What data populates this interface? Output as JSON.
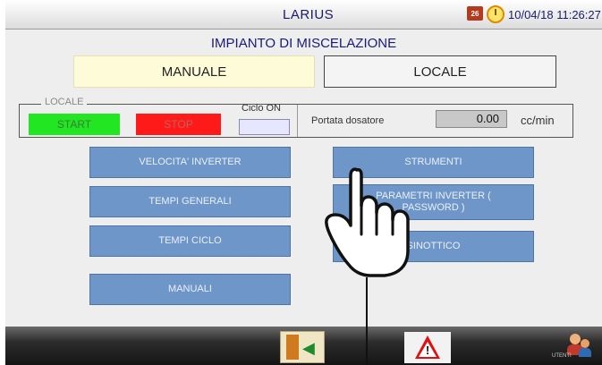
{
  "header": {
    "title": "LARIUS",
    "calendar_icon": "calendar-icon",
    "calendar_day": "26",
    "clock_icon": "clock-icon",
    "datetime": "10/04/18 11:26:27"
  },
  "page_title": "IMPIANTO DI MISCELAZIONE",
  "modes": {
    "manual_label": "MANUALE",
    "local_label": "LOCALE"
  },
  "control": {
    "group_label": "LOCALE",
    "start_label": "START",
    "stop_label": "STOP",
    "ciclo_label": "Ciclo ON",
    "portata_label": "Portata dosatore",
    "portata_value": "0.00",
    "portata_unit": "cc/min"
  },
  "menu": {
    "velocita_inverter": "VELOCITA' INVERTER",
    "tempi_generali": "TEMPI GENERALI",
    "tempi_ciclo": "TEMPI CICLO",
    "manuali": "MANUALI",
    "strumenti": "STRUMENTI",
    "parametri_inverter": "PARAMETRI INVERTER ( PASSWORD )",
    "sinottico": "SINOTTICO"
  },
  "bottom": {
    "exit_icon": "exit-door-icon",
    "warning_icon": "warning-icon",
    "users_icon": "users-icon",
    "users_label": "UTENTI"
  },
  "colors": {
    "start": "#22e622",
    "stop": "#ff1a1a",
    "menu_button": "#6f96c9",
    "manual_bg": "#fdfbd8"
  }
}
